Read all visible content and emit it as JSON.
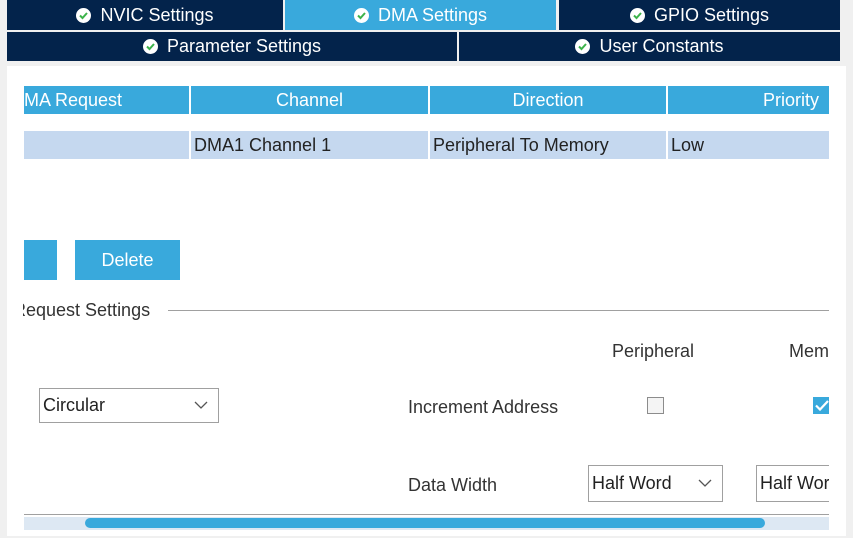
{
  "tabs_row1": [
    {
      "label": "NVIC Settings",
      "active": false
    },
    {
      "label": "DMA Settings",
      "active": true
    },
    {
      "label": "GPIO Settings",
      "active": false
    }
  ],
  "tabs_row2": [
    {
      "label": "Parameter Settings",
      "active": false
    },
    {
      "label": "User Constants",
      "active": false
    }
  ],
  "table": {
    "columns": [
      "MA Request",
      "Channel",
      "Direction",
      "Priority"
    ],
    "rows": [
      [
        "",
        "DMA1 Channel 1",
        "Peripheral To Memory",
        "Low"
      ]
    ]
  },
  "buttons": {
    "add_label": "",
    "delete_label": "Delete"
  },
  "settings": {
    "group_title": "Request Settings",
    "mode_value": "Circular",
    "peripheral_header": "Peripheral",
    "memory_header": "Memory",
    "increment_address_label": "Increment Address",
    "peripheral_increment_checked": false,
    "memory_increment_checked": true,
    "data_width_label": "Data Width",
    "peripheral_data_width": "Half Word",
    "memory_data_width": "Half Word"
  },
  "colors": {
    "tab_bg": "#03234b",
    "accent": "#39a9dc",
    "row_bg": "#c5d8ef"
  },
  "icons": {
    "tab_status": "check-circle-icon",
    "dropdown": "chevron-down-icon",
    "checkbox_checked": "checkmark-icon"
  }
}
